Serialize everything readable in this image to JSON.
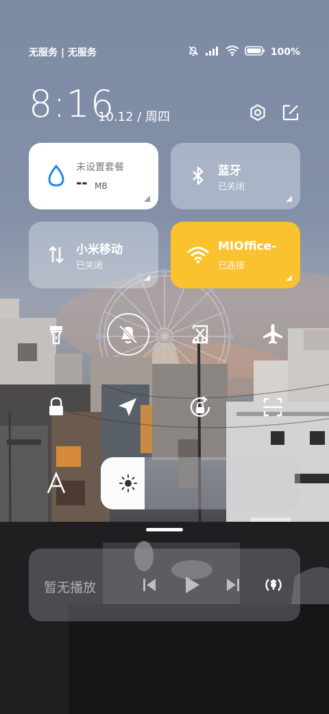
{
  "status_bar": {
    "carrier": "无服务 | 无服务",
    "battery": "100%"
  },
  "header": {
    "time": "8:16",
    "date": "10.12 / 周四",
    "settings_icon": "settings-hex-icon",
    "edit_icon": "edit-icon"
  },
  "tiles": {
    "data": {
      "title": "未设置套餐",
      "value": "--",
      "unit": "MB",
      "icon": "water-drop-icon"
    },
    "bluetooth": {
      "title": "蓝牙",
      "status": "已关闭",
      "icon": "bluetooth-icon"
    },
    "mobile": {
      "title": "小米移动",
      "status": "已关闭",
      "icon": "data-arrows-icon"
    },
    "wifi": {
      "title": "MIOffice-",
      "status": "已连接",
      "icon": "wifi-icon"
    }
  },
  "quick_toggles": [
    {
      "name": "flashlight",
      "icon": "flashlight-icon",
      "active": false
    },
    {
      "name": "mute",
      "icon": "bell-off-icon",
      "active": true
    },
    {
      "name": "screenshot",
      "icon": "scissors-icon",
      "active": false
    },
    {
      "name": "airplane",
      "icon": "airplane-icon",
      "active": false
    },
    {
      "name": "lock",
      "icon": "lock-icon",
      "active": false
    },
    {
      "name": "location",
      "icon": "location-arrow-icon",
      "active": false
    },
    {
      "name": "rotation-lock",
      "icon": "rotate-lock-icon",
      "active": false
    },
    {
      "name": "scan",
      "icon": "scan-icon",
      "active": false
    }
  ],
  "brightness": {
    "level": 0.22,
    "auto_icon": "font-a-icon"
  },
  "media": {
    "label": "暂无播放"
  },
  "colors": {
    "accent_yellow": "#f9c22e",
    "drop_blue": "#1e88e5"
  }
}
